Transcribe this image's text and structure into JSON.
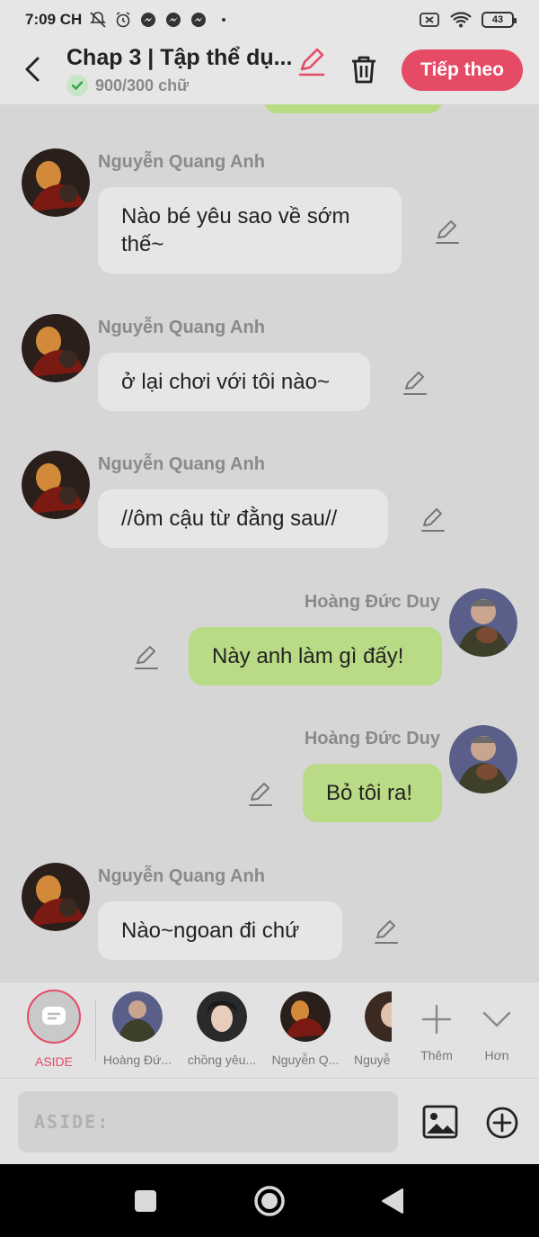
{
  "status_bar": {
    "time": "7:09 CH",
    "battery": "43"
  },
  "header": {
    "title": "Chap 3 | Tập thể dụ...",
    "char_count": "900/300 chữ",
    "next_button": "Tiếp theo"
  },
  "messages": [
    {
      "side": "left",
      "sender": "Nguyễn Quang Anh",
      "text": "Nào bé yêu sao về sớm thế~"
    },
    {
      "side": "left",
      "sender": "Nguyễn Quang Anh",
      "text": "ở lại chơi với tôi nào~"
    },
    {
      "side": "left",
      "sender": "Nguyễn Quang Anh",
      "text": "//ôm cậu từ đằng sau//"
    },
    {
      "side": "right",
      "sender": "Hoàng Đức Duy",
      "text": "Này anh làm gì đấy!"
    },
    {
      "side": "right",
      "sender": "Hoàng Đức Duy",
      "text": "Bỏ tôi ra!"
    },
    {
      "side": "left",
      "sender": "Nguyễn Quang Anh",
      "text": "Nào~ngoan đi chứ"
    }
  ],
  "roles": {
    "aside": "ASIDE",
    "items": [
      "Hoàng Đứ...",
      "chồng yêu...",
      "Nguyễn Q...",
      "Nguyễ"
    ],
    "more_label": "Thêm",
    "collapse_label": "Hơn"
  },
  "input": {
    "placeholder": "ASIDE:"
  },
  "colors": {
    "accent": "#e64b66",
    "right_bubble": "#b9db86",
    "left_bubble": "#e6e6e6",
    "background": "#d6d6d6"
  }
}
